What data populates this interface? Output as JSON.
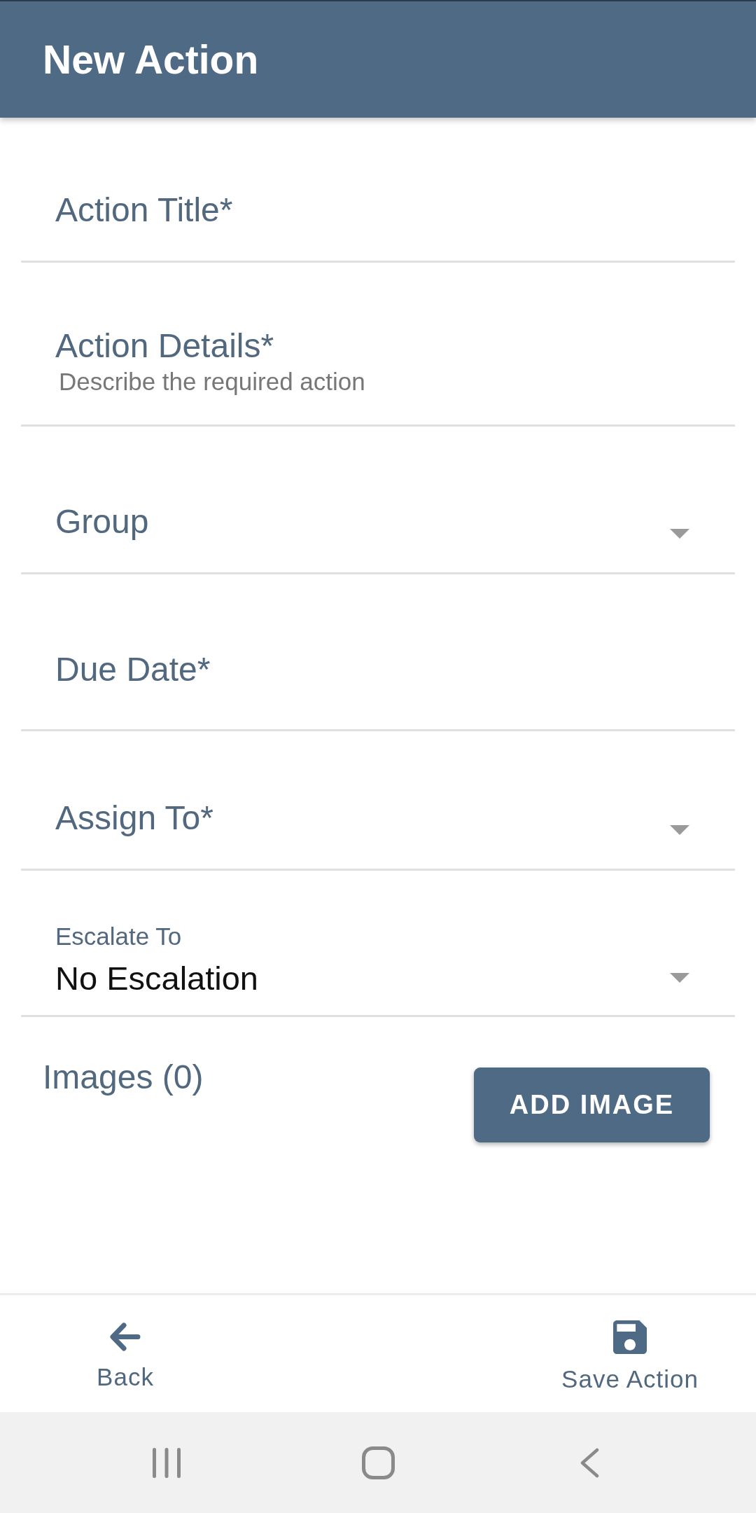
{
  "app_bar": {
    "title": "New Action"
  },
  "fields": [
    {
      "kind": "text",
      "label": "Action Title*"
    },
    {
      "kind": "text",
      "label": "Action Details*",
      "placeholder": "Describe the required action"
    },
    {
      "kind": "select",
      "label": "Group"
    },
    {
      "kind": "text",
      "label": "Due Date*"
    },
    {
      "kind": "select",
      "label": "Assign To*"
    },
    {
      "kind": "select",
      "label": "Escalate To",
      "value": "No Escalation"
    }
  ],
  "images": {
    "label": "Images (0)",
    "button": "ADD IMAGE"
  },
  "bottom_bar": [
    {
      "kind": "back",
      "label": "Back"
    },
    {
      "kind": "save",
      "label": "Save Action"
    }
  ]
}
